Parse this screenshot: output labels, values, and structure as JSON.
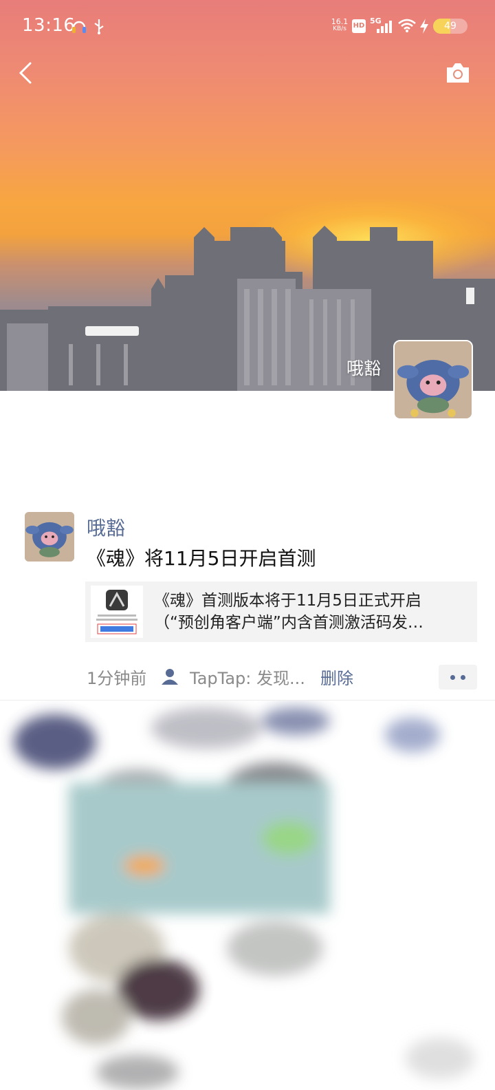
{
  "status_bar": {
    "time": "13:16",
    "net_speed_top": "16.1",
    "net_speed_unit": "KB/s",
    "hd_badge": "HD",
    "signal_label": "5G",
    "battery": "49",
    "icons": [
      "headset-icon",
      "usb-icon",
      "hd-icon",
      "signal-5g-icon",
      "wifi-icon",
      "charging-icon",
      "battery-icon"
    ]
  },
  "header": {
    "back_icon": "chevron-left-icon",
    "camera_icon": "camera-icon",
    "cover_name": "哦豁"
  },
  "post": {
    "author": "哦豁",
    "text": "《魂》将11月5日开启首测",
    "link_card": {
      "line1": "《魂》首测版本将于11月5日正式开启",
      "line2": "（“预创角客户端”内含首测激活码发…"
    },
    "meta": {
      "time": "1分钟前",
      "source": "TapTap: 发现...",
      "delete": "删除"
    }
  },
  "colors": {
    "link_blue": "#576b95",
    "meta_gray": "#8a8a8a",
    "card_bg": "#f3f3f3"
  }
}
